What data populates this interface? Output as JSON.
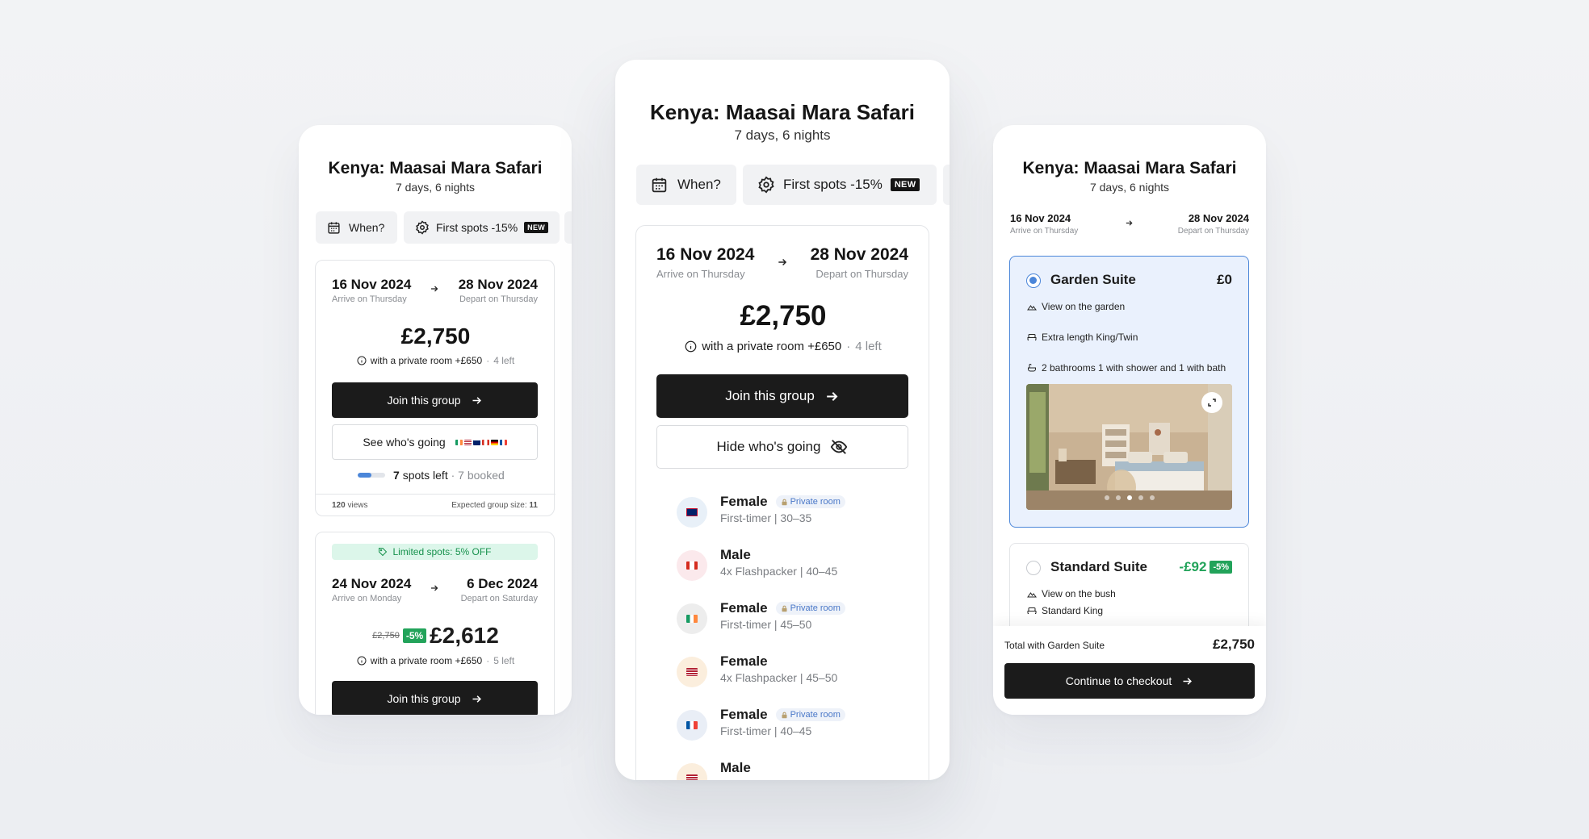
{
  "trip": {
    "title": "Kenya: Maasai Mara Safari",
    "duration": "7 days, 6 nights"
  },
  "filters": {
    "when": "When?",
    "first_spots": "First spots -15%",
    "new_badge": "NEW"
  },
  "departure1": {
    "start_date": "16 Nov 2024",
    "start_sub": "Arrive on Thursday",
    "end_date": "28 Nov 2024",
    "end_sub": "Depart on Thursday",
    "price": "£2,750",
    "private_room": "with a private room +£650",
    "sep": "·",
    "left": "4 left",
    "join": "Join this group",
    "see_going": "See who's going",
    "hide_going": "Hide who's going",
    "spots_left_num": "7",
    "spots_left_label": "spots left",
    "booked": "7 booked",
    "booked_fraction": 0.5,
    "views_num": "120",
    "views_label": "views",
    "expected_label": "Expected group size:",
    "expected_num": "11"
  },
  "departure2": {
    "badge": "Limited spots: 5% OFF",
    "start_date": "24 Nov 2024",
    "start_sub": "Arrive on Monday",
    "end_date": "6 Dec 2024",
    "end_sub": "Depart on Saturday",
    "old_price": "£2,750",
    "discount": "-5%",
    "price": "£2,612",
    "private_room": "with a private room +£650",
    "left": "5 left",
    "join": "Join this group"
  },
  "travelers": [
    {
      "gender": "Female",
      "private": true,
      "desc": "First-timer | 30–35",
      "flag": "gb"
    },
    {
      "gender": "Male",
      "private": false,
      "desc": "4x Flashpacker | 40–45",
      "flag": "ca"
    },
    {
      "gender": "Female",
      "private": true,
      "desc": "First-timer | 45–50",
      "flag": "ie"
    },
    {
      "gender": "Female",
      "private": false,
      "desc": "4x Flashpacker | 45–50",
      "flag": "us"
    },
    {
      "gender": "Female",
      "private": true,
      "desc": "First-timer | 40–45",
      "flag": "fr"
    },
    {
      "gender": "Male",
      "private": false,
      "desc": "",
      "flag": "us"
    }
  ],
  "private_room_label": "Private room",
  "rooms": {
    "garden": {
      "name": "Garden Suite",
      "price": "£0",
      "features": [
        "View on the garden",
        "Extra length King/Twin",
        "2 bathrooms 1 with shower and 1 with bath"
      ]
    },
    "standard": {
      "name": "Standard Suite",
      "price": "-£92",
      "discount": "-5%",
      "features": [
        "View on the bush",
        "Standard King"
      ]
    }
  },
  "checkout": {
    "total_label": "Total with Garden Suite",
    "total": "£2,750",
    "button": "Continue to checkout"
  },
  "colors": {
    "dark": "#1b1b1b",
    "accent_blue": "#4b86d9",
    "green": "#22a35a",
    "selected_bg": "#eaf1fd"
  }
}
